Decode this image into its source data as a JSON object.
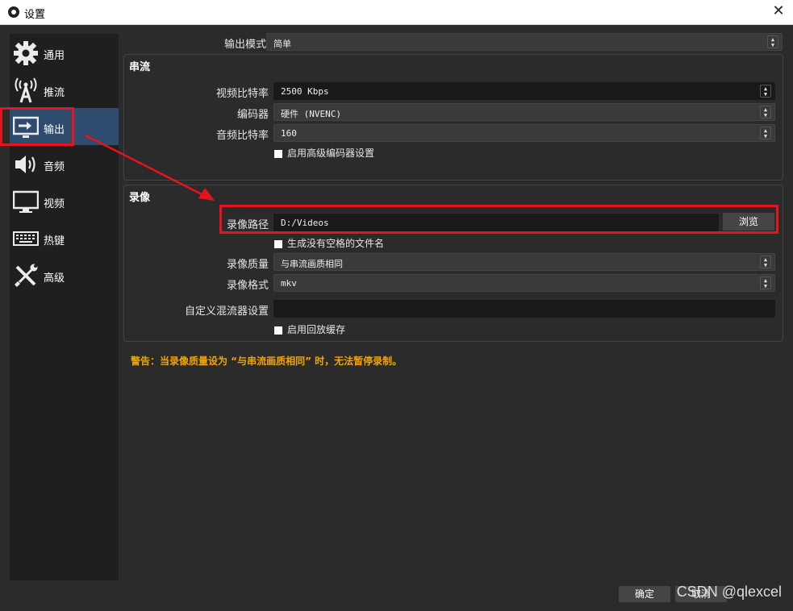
{
  "window": {
    "title": "设置",
    "close_label": "✕"
  },
  "sidebar": {
    "items": [
      {
        "label": "通用",
        "icon": "gear-icon"
      },
      {
        "label": "推流",
        "icon": "antenna-icon"
      },
      {
        "label": "输出",
        "icon": "output-monitor-icon"
      },
      {
        "label": "音频",
        "icon": "speaker-icon"
      },
      {
        "label": "视频",
        "icon": "monitor-icon"
      },
      {
        "label": "热键",
        "icon": "keyboard-icon"
      },
      {
        "label": "高级",
        "icon": "tools-icon"
      }
    ],
    "active_index": 2
  },
  "output_mode": {
    "label": "输出模式",
    "value": "简单"
  },
  "streaming": {
    "title": "串流",
    "video_bitrate": {
      "label": "视频比特率",
      "value": "2500 Kbps"
    },
    "encoder": {
      "label": "编码器",
      "value": "硬件 (NVENC)"
    },
    "audio_bitrate": {
      "label": "音频比特率",
      "value": "160"
    },
    "advanced_encoder": {
      "label": "启用高级编码器设置"
    }
  },
  "recording": {
    "title": "录像",
    "path": {
      "label": "录像路径",
      "value": "D:/Videos",
      "browse_label": "浏览"
    },
    "no_space_filename": {
      "label": "生成没有空格的文件名"
    },
    "quality": {
      "label": "录像质量",
      "value": "与串流画质相同"
    },
    "format": {
      "label": "录像格式",
      "value": "mkv"
    },
    "muxer": {
      "label": "自定义混流器设置",
      "value": ""
    },
    "replay_buffer": {
      "label": "启用回放缓存"
    }
  },
  "warning": "警告：当录像质量设为 “与串流画质相同” 时，无法暂停录制。",
  "footer": {
    "ok_label": "确定",
    "cancel_label": "取消"
  },
  "watermark": "CSDN @qlexcel",
  "colors": {
    "highlight": "#e8141b",
    "warning": "#f0a30a",
    "active_nav": "#2f4b6e"
  }
}
